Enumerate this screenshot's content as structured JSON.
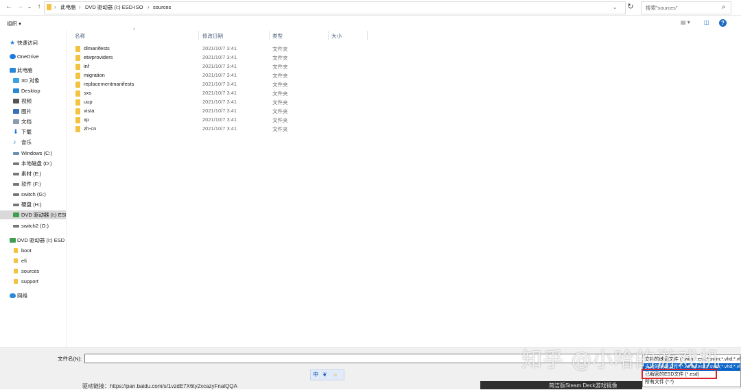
{
  "address": {
    "back": "←",
    "forward": "→",
    "history": "⌄",
    "up": "↑",
    "crumbs": [
      "此电脑",
      "DVD 驱动器 (I:) ESD-ISO",
      "sources"
    ],
    "dropdown": "⌄",
    "refresh": "↻"
  },
  "search": {
    "placeholder": "搜索\"sources\"",
    "icon": "⌕"
  },
  "toolbar": {
    "organize": "组织 ▾",
    "view_icon": "▤ ▾",
    "pane_icon": "◫",
    "help": "?"
  },
  "nav": [
    {
      "label": "快速访问",
      "icon": "star-icon",
      "color": "#1e7be0"
    },
    {
      "label": "OneDrive",
      "icon": "cloud-icon",
      "color": "#1e7be0"
    },
    {
      "label": "此电脑",
      "icon": "computer-icon",
      "color": "#2b88d8"
    },
    {
      "label": "3D 对象",
      "icon": "cube-icon",
      "color": "#39a3e0"
    },
    {
      "label": "Desktop",
      "icon": "desktop-icon",
      "color": "#2b88d8"
    },
    {
      "label": "视频",
      "icon": "video-icon",
      "color": "#555555"
    },
    {
      "label": "图片",
      "icon": "picture-icon",
      "color": "#3b6fb6"
    },
    {
      "label": "文档",
      "icon": "document-icon",
      "color": "#8b9bb0"
    },
    {
      "label": "下载",
      "icon": "download-icon",
      "color": "#1e7be0"
    },
    {
      "label": "音乐",
      "icon": "music-icon",
      "color": "#1e7be0"
    },
    {
      "label": "Windows (C:)",
      "icon": "drive-icon",
      "color": "#6b8fb5"
    },
    {
      "label": "本地磁盘 (D:)",
      "icon": "drive-icon",
      "color": "#777777"
    },
    {
      "label": "素材 (E:)",
      "icon": "drive-icon",
      "color": "#777777"
    },
    {
      "label": "软件 (F:)",
      "icon": "drive-icon",
      "color": "#777777"
    },
    {
      "label": "switch (G:)",
      "icon": "drive-icon",
      "color": "#777777"
    },
    {
      "label": "硬盘 (H:)",
      "icon": "drive-icon",
      "color": "#777777"
    },
    {
      "label": "DVD 驱动器 (I:) ESI",
      "icon": "dvd-icon",
      "color": "#3f9e4f"
    },
    {
      "label": "switch2 (O:)",
      "icon": "drive-icon",
      "color": "#777777"
    },
    {
      "label": "DVD 驱动器 (I:) ESD",
      "icon": "dvd-icon",
      "color": "#3f9e4f"
    },
    {
      "label": "boot",
      "icon": "folder-icon",
      "color": "#f4c241"
    },
    {
      "label": "efi",
      "icon": "folder-icon",
      "color": "#f4c241"
    },
    {
      "label": "sources",
      "icon": "folder-icon",
      "color": "#f4c241"
    },
    {
      "label": "support",
      "icon": "folder-icon",
      "color": "#f4c241"
    },
    {
      "label": "网络",
      "icon": "network-icon",
      "color": "#2b88d8"
    }
  ],
  "columns": {
    "name": "名称",
    "date": "修改日期",
    "type": "类型",
    "size": "大小"
  },
  "files": [
    {
      "name": "dlmanifests",
      "date": "2021/10/7 3:41",
      "type": "文件夹"
    },
    {
      "name": "etwproviders",
      "date": "2021/10/7 3:41",
      "type": "文件夹"
    },
    {
      "name": "inf",
      "date": "2021/10/7 3:41",
      "type": "文件夹"
    },
    {
      "name": "migration",
      "date": "2021/10/7 3:41",
      "type": "文件夹"
    },
    {
      "name": "replacementmanifests",
      "date": "2021/10/7 3:41",
      "type": "文件夹"
    },
    {
      "name": "sxs",
      "date": "2021/10/7 3:41",
      "type": "文件夹"
    },
    {
      "name": "uup",
      "date": "2021/10/7 3:41",
      "type": "文件夹"
    },
    {
      "name": "vista",
      "date": "2021/10/7 3:41",
      "type": "文件夹"
    },
    {
      "name": "xp",
      "date": "2021/10/7 3:41",
      "type": "文件夹"
    },
    {
      "name": "zh-cn",
      "date": "2021/10/7 3:41",
      "type": "文件夹"
    }
  ],
  "bottom": {
    "filename_label": "文件名(N):",
    "filename_value": "",
    "filetypes": [
      {
        "label": "支持的映像文件 (*.wim;*.esd;*.swm;*.vhd;*.vhdx;*.iso)",
        "selected": false
      },
      {
        "label": "支持的映像文件 (*.wim;*.esd;*.swm;*.vhd;*.vhdx;*.iso)",
        "selected": true
      },
      {
        "label": "已解密的ESD文件 (*.esd)",
        "selected": false
      },
      {
        "label": "所有文件 (*.*)",
        "selected": false
      }
    ],
    "ime": [
      "中",
      "❦",
      "☼"
    ],
    "caption": "驱动链接：https://pan.baidu.com/s/1vzdE7X6ty2xcazyFnalQQA",
    "caption_right": "简洁版Steam Deck游戏镜像"
  },
  "watermark": "知乎 @小哈的游戏机"
}
